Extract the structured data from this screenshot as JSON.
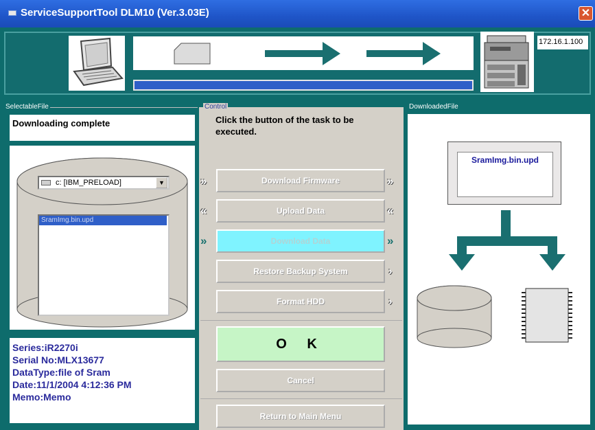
{
  "window": {
    "title": "ServiceSupportTool DLM10 (Ver.3.03E)",
    "close": "✕"
  },
  "header": {
    "ip_address": "172.16.1.100",
    "progress_fraction": 1.0
  },
  "left_panel": {
    "group_label": "SelectableFile",
    "status": "Downloading complete",
    "drive_value": "c: [IBM_PRELOAD]",
    "files": [
      "SramImg.bin.upd"
    ],
    "info": {
      "series": "Series:iR2270i",
      "serial": "Serial No:MLX13677",
      "datatype": "DataType:file of Sram",
      "date": "Date:11/1/2004 4:12:36 PM",
      "memo": "Memo:Memo"
    }
  },
  "control": {
    "group_label": "Control",
    "instruction": "Click the button of the task to be executed.",
    "buttons": {
      "download_firmware": "Download Firmware",
      "upload_data": "Upload Data",
      "download_data": "Download Data",
      "restore_backup": "Restore Backup System",
      "format_hdd": "Format HDD",
      "ok": "O K",
      "cancel": "Cancel",
      "return": "Return to Main Menu"
    }
  },
  "right_panel": {
    "group_label": "DownloadedFile",
    "file_name": "SramImg.bin.upd"
  },
  "colors": {
    "frame_teal": "#0e6c6c",
    "title_blue": "#1f55c8",
    "progress_blue": "#2f5fc8",
    "active_button": "#7ff3ff",
    "ok_button": "#c6f5c6",
    "info_text": "#2a2a9c"
  }
}
